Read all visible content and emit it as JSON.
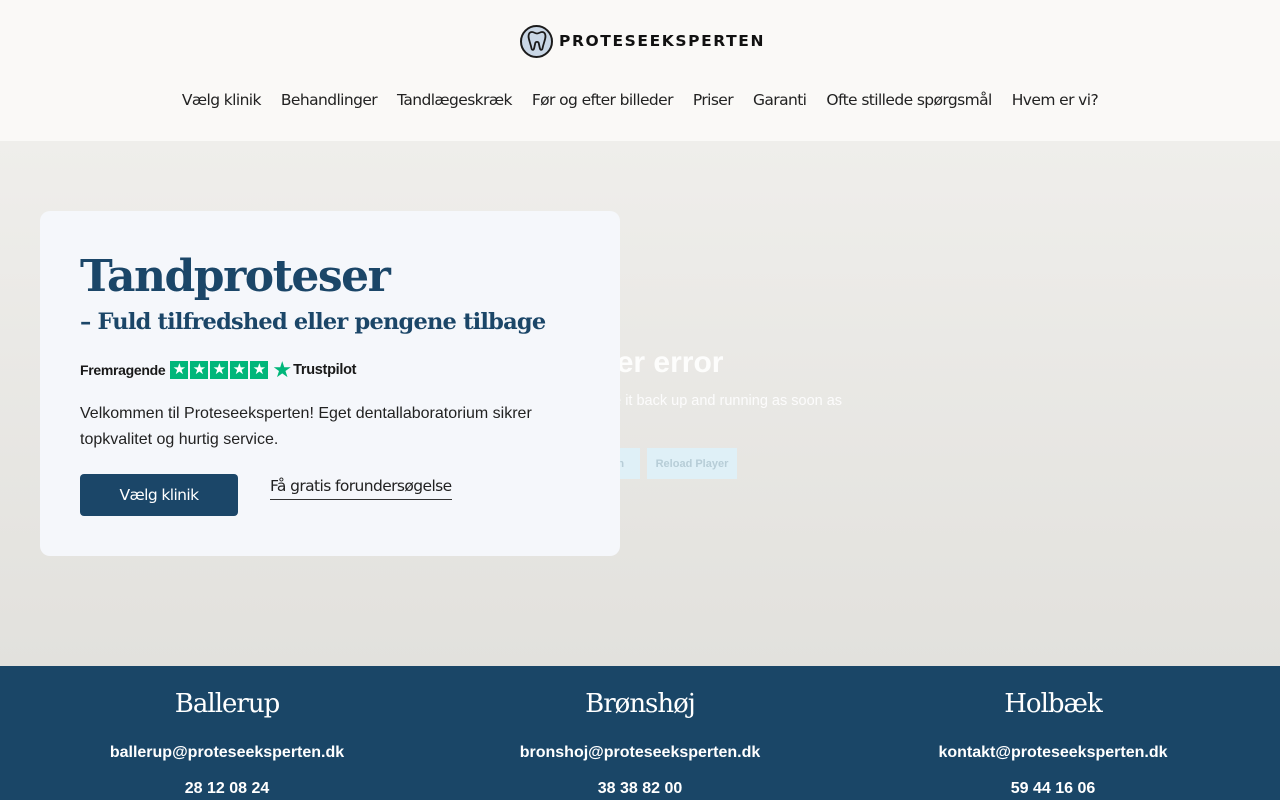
{
  "header": {
    "brand": "PROTESEEKSPERTEN",
    "nav": [
      "Vælg klinik",
      "Behandlinger",
      "Tandlægeskræk",
      "Før og efter billeder",
      "Priser",
      "Garanti",
      "Ofte stillede spørgsmål",
      "Hvem er vi?"
    ]
  },
  "player": {
    "title": "Player error",
    "message": "We'll have it back up and running as soon as possible.",
    "button_1": "Try again",
    "button_2": "Reload Player"
  },
  "hero": {
    "title": "Tandproteser",
    "subtitle": "– Fuld tilfredshed eller pengene tilbage",
    "trust_rating": "Fremragende",
    "trust_brand": "Trustpilot",
    "trust_stars": 5,
    "body": "Velkommen til Proteseeksperten! Eget dentallaboratorium sikrer topkvalitet og hurtig service.",
    "cta_primary": "Vælg klinik",
    "cta_secondary": "Få gratis forundersøgelse"
  },
  "colors": {
    "brand_blue": "#1b4668",
    "trustpilot_green": "#00b67a",
    "header_bg": "#faf9f7",
    "card_bg": "#f5f7fb"
  },
  "footer": {
    "locations": [
      {
        "name": "Ballerup",
        "email": "ballerup@proteseeksperten.dk",
        "phone": "28 12 08 24"
      },
      {
        "name": "Brønshøj",
        "email": "bronshoj@proteseeksperten.dk",
        "phone": "38 38 82 00"
      },
      {
        "name": "Holbæk",
        "email": "kontakt@proteseeksperten.dk",
        "phone": "59 44 16 06"
      }
    ]
  }
}
